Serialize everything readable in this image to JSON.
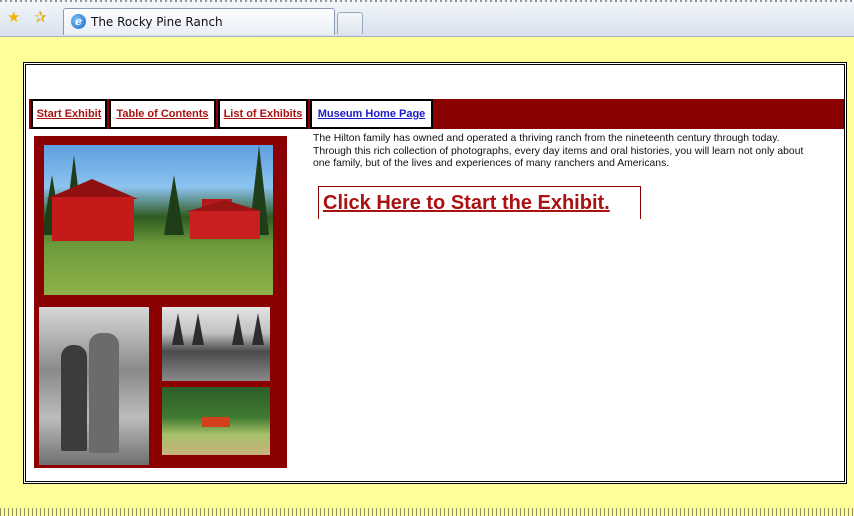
{
  "browser": {
    "tab_title": "The Rocky Pine Ranch",
    "favorites_icon": "star-icon",
    "add_favorites_icon": "star-add-icon",
    "tab_icon": "ie-icon"
  },
  "nav": {
    "items": [
      {
        "label": "Start Exhibit",
        "color": "#aa1111"
      },
      {
        "label": "Table of Contents",
        "color": "#aa1111"
      },
      {
        "label": "List of Exhibits",
        "color": "#aa1111"
      },
      {
        "label": "Museum Home Page",
        "color": "#1a1acc"
      }
    ],
    "bar_color": "#8b0000"
  },
  "main": {
    "intro": "The Hilton family has owned and operated a thriving ranch from the nineteenth century through today. Through this rich collection of photographs, every day items and oral histories, you will learn not only about one family, but of the lives and experiences of many ranchers and Americans.",
    "cta": "Click Here to Start the Exhibit."
  },
  "colors": {
    "page_background": "#ffff99",
    "accent": "#8b0000"
  }
}
